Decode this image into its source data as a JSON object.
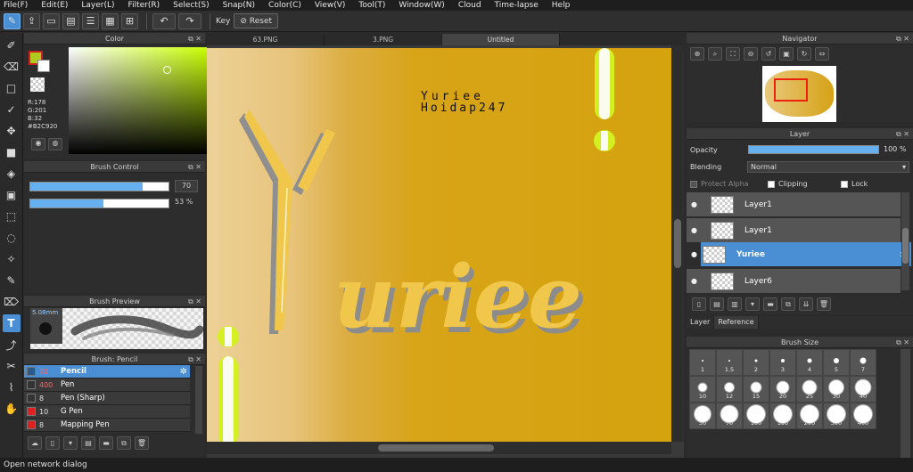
{
  "menu": [
    "File(F)",
    "Edit(E)",
    "Layer(L)",
    "Filter(R)",
    "Select(S)",
    "Snap(N)",
    "Color(C)",
    "View(V)",
    "Tool(T)",
    "Window(W)",
    "Cloud",
    "Time-lapse",
    "Help"
  ],
  "toolbar": {
    "key_label": "Key",
    "reset_label": "Reset"
  },
  "color_panel": {
    "title": "Color",
    "r": "R:178",
    "g": "G:201",
    "b": "B:32",
    "hex": "#B2C920",
    "fg_color": "#b2c920"
  },
  "brush_control": {
    "title": "Brush Control",
    "size_value": "70",
    "size_fill": 0.81,
    "opacity_value": "53 %",
    "opacity_fill": 0.53
  },
  "brush_preview": {
    "title": "Brush Preview",
    "size_label": "5.08mm"
  },
  "brush_list": {
    "title": "Brush: Pencil",
    "items": [
      {
        "num": "70",
        "name": "Pencil",
        "color": "#3a6ea5"
      },
      {
        "num": "400",
        "name": "Pen",
        "color": "#333333"
      },
      {
        "num": "8",
        "name": "Pen (Sharp)",
        "color": "#333333"
      },
      {
        "num": "10",
        "name": "G Pen",
        "color": "#e02020"
      },
      {
        "num": "8",
        "name": "Mapping Pen",
        "color": "#e02020"
      }
    ]
  },
  "tabs": [
    "63.PNG",
    "3.PNG",
    "Untitled"
  ],
  "canvas": {
    "line1": "Yuriee",
    "line2": "Hoidap247",
    "word": "uriee",
    "letter": "Y"
  },
  "navigator": {
    "title": "Navigator"
  },
  "layer_panel": {
    "title": "Layer",
    "opacity_label": "Opacity",
    "opacity_value": "100 %",
    "blending_label": "Blending",
    "blending_value": "Normal",
    "protect_alpha": "Protect Alpha",
    "clipping": "Clipping",
    "lock": "Lock",
    "layers": [
      "Layer1",
      "Layer1",
      "Yuriee",
      "Layer6"
    ]
  },
  "bottom_tabs": [
    "Layer",
    "Reference"
  ],
  "brush_size": {
    "title": "Brush Size",
    "rows": [
      [
        "1",
        "1.5",
        "2",
        "3",
        "4",
        "5",
        "7"
      ],
      [
        "10",
        "12",
        "15",
        "20",
        "25",
        "30",
        "40"
      ],
      [
        "50",
        "70",
        "100",
        "150",
        "200",
        "300",
        "400"
      ]
    ]
  },
  "status": "Open network dialog"
}
